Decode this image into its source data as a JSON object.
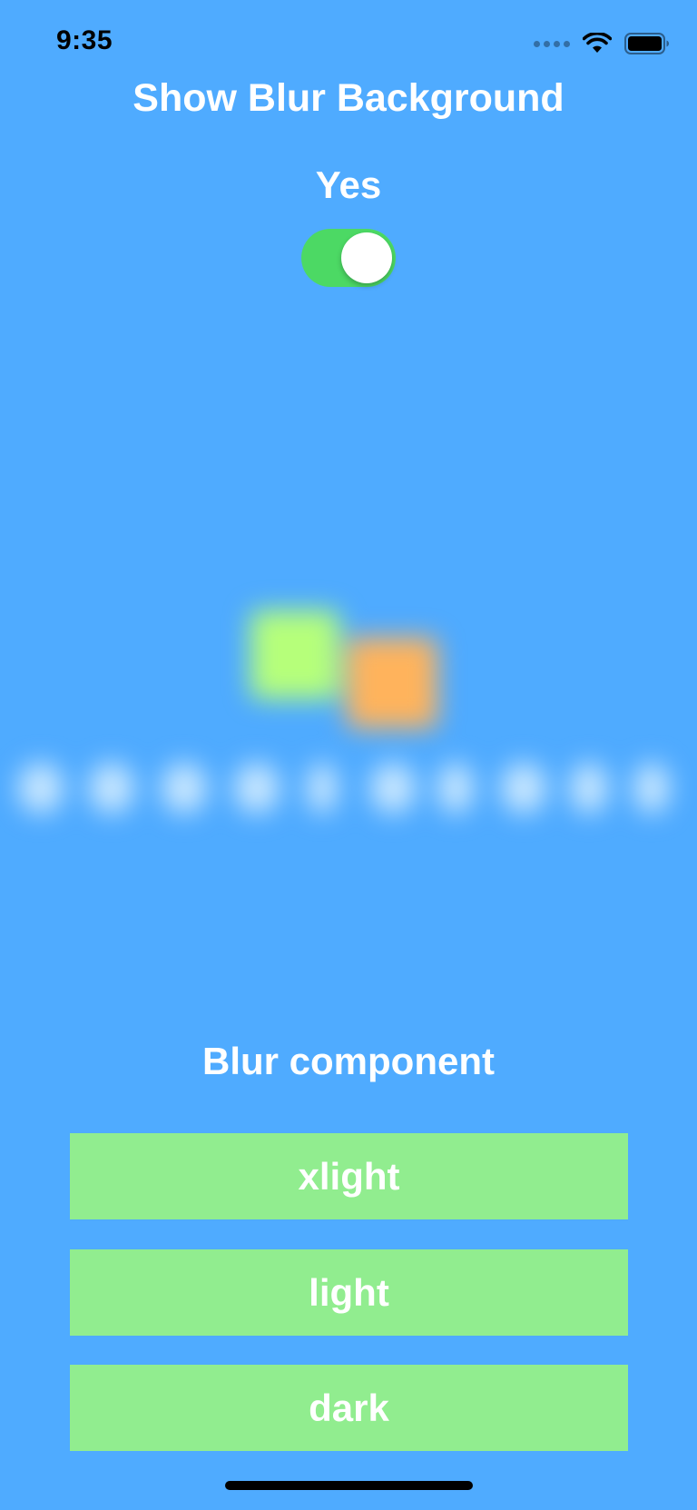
{
  "status_bar": {
    "time": "9:35",
    "signal_icon": "signal-dots-icon",
    "wifi_icon": "wifi-icon",
    "battery_icon": "battery-icon"
  },
  "header": {
    "title": "Show Blur Background"
  },
  "toggle_section": {
    "label": "Yes",
    "toggle_on": true
  },
  "blur_section": {
    "label": "Blur component",
    "buttons": [
      {
        "label": "xlight"
      },
      {
        "label": "light"
      },
      {
        "label": "dark"
      }
    ]
  },
  "colors": {
    "background": "#4fabff",
    "toggle_on": "#4cd964",
    "button_bg": "#91ed8f",
    "text": "#ffffff"
  }
}
